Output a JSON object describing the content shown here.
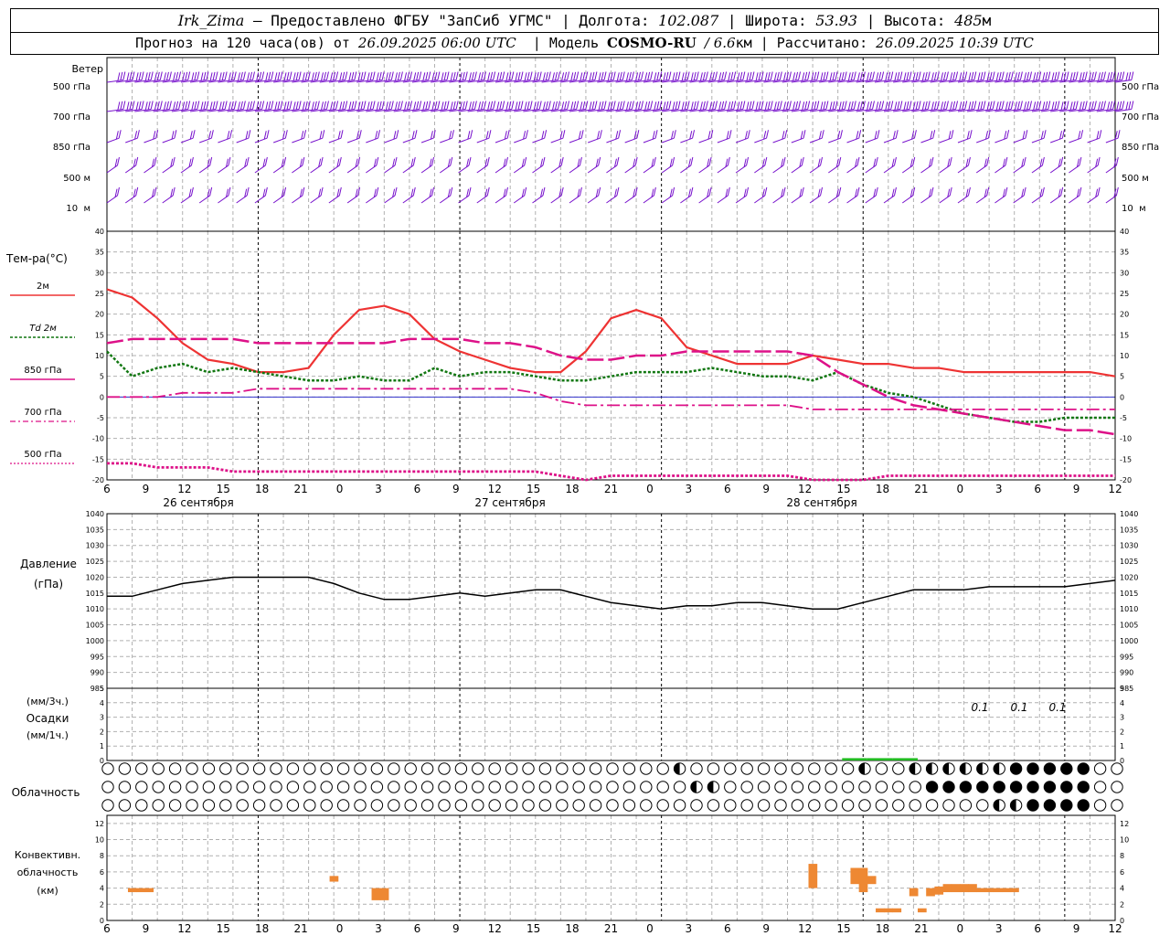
{
  "header": {
    "station": "Irk_Zima",
    "provider": "– Предоставлено ФГБУ \"ЗапСиб УГМС\"",
    "lon_label": "Долгота:",
    "lon_value": "102.087",
    "lat_label": "Широта:",
    "lat_value": "53.93",
    "alt_label": "Высота:",
    "alt_value": "485",
    "alt_unit": "м",
    "forecast_prefix": "Прогноз на 120 часа(ов) от",
    "forecast_start": "26.09.2025 06:00 UTC",
    "model_label": "Модель",
    "model_name": "COSMO-RU",
    "model_res": "/ 6.6",
    "model_res_unit": "км",
    "calc_label": "Рассчитано:",
    "calc_time": "26.09.2025 10:39 UTC"
  },
  "colors": {
    "t2m": "#ee3333",
    "td2m": "#117711",
    "isobaric": "#dd1188",
    "wind": "#7711cc",
    "pressure": "#000000",
    "precip": "#22bb22",
    "convective": "#ee8833",
    "grid": "#b0b0b0"
  },
  "wind_panel": {
    "title": "Ветер",
    "levels": [
      "500 гПа",
      "700 гПа",
      "850 гПа",
      "500 м",
      "10  м"
    ],
    "right_levels": [
      "500 гПа",
      "700 гПа",
      "850 гПа",
      "500 м",
      "10  м"
    ]
  },
  "temp_panel": {
    "ylabel": "Тем-ра(°С)",
    "legend": [
      {
        "label": "2м"
      },
      {
        "label": "Td 2м"
      },
      {
        "label": "850 гПа"
      },
      {
        "label": "700 гПа"
      },
      {
        "label": "500 гПа"
      }
    ]
  },
  "x_axis": {
    "hour_labels": [
      "6",
      "9",
      "12",
      "15",
      "18",
      "21",
      "0",
      "3",
      "6",
      "9",
      "12",
      "15",
      "18",
      "21",
      "0",
      "3",
      "6",
      "9",
      "12",
      "15",
      "18",
      "21",
      "0",
      "3",
      "6",
      "9",
      "12"
    ],
    "dates": [
      "26 сентября",
      "27 сентября",
      "28 сентября"
    ]
  },
  "pressure_panel": {
    "ylabel1": "Давление",
    "ylabel2": "(гПа)"
  },
  "precip_panel": {
    "ylabel1": "(мм/3ч.)",
    "ylabel2": "Осадки",
    "ylabel3": "(мм/1ч.)",
    "annotations": [
      "0.1",
      "0.1",
      "0.1"
    ]
  },
  "cloud_panel": {
    "ylabel": "Облачность"
  },
  "conv_panel": {
    "ylabel1": "Конвективн.",
    "ylabel2": "облачность",
    "ylabel3": "(км)"
  },
  "chart_data": [
    {
      "type": "line",
      "title": "Тем-ра(°С)",
      "x_hours": [
        0,
        3,
        6,
        9,
        12,
        15,
        18,
        21,
        24,
        27,
        30,
        33,
        36,
        39,
        42,
        45,
        48,
        51,
        54,
        57,
        60,
        63,
        66,
        69,
        72,
        75,
        78,
        81,
        84,
        87,
        90,
        93,
        96,
        99,
        102,
        105,
        108,
        111,
        114,
        117,
        120
      ],
      "ylim": [
        -20,
        40
      ],
      "series": [
        {
          "name": "2м",
          "values": [
            26,
            24,
            19,
            13,
            9,
            8,
            6,
            6,
            7,
            15,
            21,
            22,
            20,
            14,
            11,
            9,
            7,
            6,
            6,
            11,
            19,
            21,
            19,
            12,
            10,
            8,
            8,
            8,
            10,
            9,
            8,
            8,
            7,
            7,
            6,
            6,
            6,
            6,
            6,
            6,
            5
          ]
        },
        {
          "name": "Td 2м",
          "values": [
            11,
            5,
            7,
            8,
            6,
            7,
            6,
            5,
            4,
            4,
            5,
            4,
            4,
            7,
            5,
            6,
            6,
            5,
            4,
            4,
            5,
            6,
            6,
            6,
            7,
            6,
            5,
            5,
            4,
            6,
            3,
            1,
            0,
            -2,
            -4,
            -5,
            -6,
            -6,
            -5,
            -5,
            -5
          ]
        },
        {
          "name": "850 гПа",
          "values": [
            13,
            14,
            14,
            14,
            14,
            14,
            13,
            13,
            13,
            13,
            13,
            13,
            14,
            14,
            14,
            13,
            13,
            12,
            10,
            9,
            9,
            10,
            10,
            11,
            11,
            11,
            11,
            11,
            10,
            6,
            3,
            0,
            -2,
            -3,
            -4,
            -5,
            -6,
            -7,
            -8,
            -8,
            -9
          ]
        },
        {
          "name": "700 гПа",
          "values": [
            0,
            0,
            0,
            1,
            1,
            1,
            2,
            2,
            2,
            2,
            2,
            2,
            2,
            2,
            2,
            2,
            2,
            1,
            -1,
            -2,
            -2,
            -2,
            -2,
            -2,
            -2,
            -2,
            -2,
            -2,
            -3,
            -3,
            -3,
            -3,
            -3,
            -3,
            -3,
            -3,
            -3,
            -3,
            -3,
            -3,
            -3
          ]
        },
        {
          "name": "500 гПа",
          "values": [
            -16,
            -16,
            -17,
            -17,
            -17,
            -18,
            -18,
            -18,
            -18,
            -18,
            -18,
            -18,
            -18,
            -18,
            -18,
            -18,
            -18,
            -18,
            -19,
            -20,
            -19,
            -19,
            -19,
            -19,
            -19,
            -19,
            -19,
            -19,
            -20,
            -20,
            -20,
            -19,
            -19,
            -19,
            -19,
            -19,
            -19,
            -19,
            -19,
            -19,
            -19
          ]
        }
      ]
    },
    {
      "type": "line",
      "title": "Давление (гПа)",
      "x_hours": [
        0,
        3,
        6,
        9,
        12,
        15,
        18,
        21,
        24,
        27,
        30,
        33,
        36,
        39,
        42,
        45,
        48,
        51,
        54,
        57,
        60,
        63,
        66,
        69,
        72,
        75,
        78,
        81,
        84,
        87,
        90,
        93,
        96,
        99,
        102,
        105,
        108,
        111,
        114,
        117,
        120
      ],
      "ylim": [
        985,
        1040
      ],
      "series": [
        {
          "name": "Давление",
          "values": [
            1014,
            1014,
            1016,
            1018,
            1019,
            1020,
            1020,
            1020,
            1020,
            1018,
            1015,
            1013,
            1013,
            1014,
            1015,
            1014,
            1015,
            1016,
            1016,
            1014,
            1012,
            1011,
            1010,
            1011,
            1011,
            1012,
            1012,
            1011,
            1010,
            1010,
            1012,
            1014,
            1016,
            1016,
            1016,
            1017,
            1017,
            1017,
            1017,
            1018,
            1019
          ]
        }
      ]
    },
    {
      "type": "bar",
      "title": "Осадки (мм/3ч.)",
      "ylim": [
        0,
        5
      ],
      "bars": [
        {
          "x_hours": 89,
          "value": 0.1
        },
        {
          "x_hours": 92,
          "value": 0.1
        },
        {
          "x_hours": 95,
          "value": 0.1
        }
      ]
    },
    {
      "type": "bar",
      "title": "Конвективн. облачность (км)",
      "ylim": [
        0,
        13
      ],
      "segments": [
        {
          "x_hours": 3,
          "bottom": 3.5,
          "top": 4.0
        },
        {
          "x_hours": 4,
          "bottom": 3.5,
          "top": 4.0
        },
        {
          "x_hours": 5,
          "bottom": 3.5,
          "top": 4.0
        },
        {
          "x_hours": 27,
          "bottom": 4.8,
          "top": 5.5
        },
        {
          "x_hours": 32,
          "bottom": 2.5,
          "top": 4.0
        },
        {
          "x_hours": 33,
          "bottom": 2.5,
          "top": 4.0
        },
        {
          "x_hours": 84,
          "bottom": 4.0,
          "top": 7.0
        },
        {
          "x_hours": 89,
          "bottom": 4.5,
          "top": 6.5
        },
        {
          "x_hours": 90,
          "bottom": 3.5,
          "top": 6.5
        },
        {
          "x_hours": 91,
          "bottom": 4.5,
          "top": 5.5
        },
        {
          "x_hours": 92,
          "bottom": 1.0,
          "top": 1.5
        },
        {
          "x_hours": 93,
          "bottom": 1.0,
          "top": 1.5
        },
        {
          "x_hours": 94,
          "bottom": 1.0,
          "top": 1.5
        },
        {
          "x_hours": 96,
          "bottom": 3.0,
          "top": 4.0
        },
        {
          "x_hours": 97,
          "bottom": 1.0,
          "top": 1.5
        },
        {
          "x_hours": 98,
          "bottom": 3.0,
          "top": 4.0
        },
        {
          "x_hours": 99,
          "bottom": 3.2,
          "top": 4.2
        },
        {
          "x_hours": 100,
          "bottom": 3.5,
          "top": 4.5
        },
        {
          "x_hours": 101,
          "bottom": 3.5,
          "top": 4.5
        },
        {
          "x_hours": 102,
          "bottom": 3.5,
          "top": 4.5
        },
        {
          "x_hours": 103,
          "bottom": 3.5,
          "top": 4.5
        },
        {
          "x_hours": 104,
          "bottom": 3.5,
          "top": 4.0
        },
        {
          "x_hours": 105,
          "bottom": 3.5,
          "top": 4.0
        },
        {
          "x_hours": 106,
          "bottom": 3.5,
          "top": 4.0
        },
        {
          "x_hours": 107,
          "bottom": 3.5,
          "top": 4.0
        },
        {
          "x_hours": 108,
          "bottom": 3.5,
          "top": 4.0
        }
      ]
    }
  ]
}
